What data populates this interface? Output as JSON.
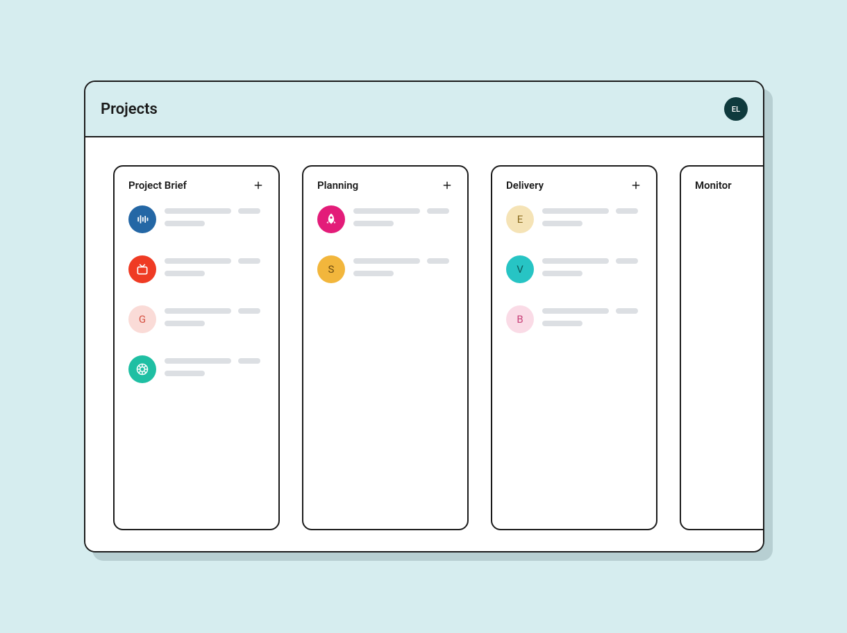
{
  "page_title": "Projects",
  "user_avatar": {
    "initials": "EL",
    "bg": "#0f3a3d"
  },
  "columns": [
    {
      "title": "Project Brief",
      "has_add": true,
      "cards": [
        {
          "badge": {
            "type": "icon",
            "icon": "audio-bars",
            "bg": "#2467a5",
            "fg": "#ffffff"
          }
        },
        {
          "badge": {
            "type": "icon",
            "icon": "tv",
            "bg": "#ef3b24",
            "fg": "#ffffff"
          }
        },
        {
          "badge": {
            "type": "letter",
            "text": "G",
            "bg": "#fadbd7",
            "fg": "#d54f3f"
          }
        },
        {
          "badge": {
            "type": "icon",
            "icon": "aperture",
            "bg": "#1fbfa3",
            "fg": "#ffffff"
          }
        }
      ]
    },
    {
      "title": "Planning",
      "has_add": true,
      "cards": [
        {
          "badge": {
            "type": "icon",
            "icon": "rocket",
            "bg": "#e31c79",
            "fg": "#ffffff"
          }
        },
        {
          "badge": {
            "type": "letter",
            "text": "S",
            "bg": "#f2b63c",
            "fg": "#6b4a0f"
          }
        }
      ]
    },
    {
      "title": "Delivery",
      "has_add": true,
      "cards": [
        {
          "badge": {
            "type": "letter",
            "text": "E",
            "bg": "#f5e3b6",
            "fg": "#8a6b1f"
          }
        },
        {
          "badge": {
            "type": "letter",
            "text": "V",
            "bg": "#27c4c4",
            "fg": "#0d5a5a"
          }
        },
        {
          "badge": {
            "type": "letter",
            "text": "B",
            "bg": "#fadbe6",
            "fg": "#c9437a"
          }
        }
      ]
    },
    {
      "title": "Monitor",
      "has_add": false,
      "cards": []
    }
  ],
  "icons": {
    "plus": "plus-icon",
    "audio-bars": "audio-bars-icon",
    "tv": "tv-icon",
    "rocket": "rocket-icon",
    "aperture": "aperture-icon"
  }
}
